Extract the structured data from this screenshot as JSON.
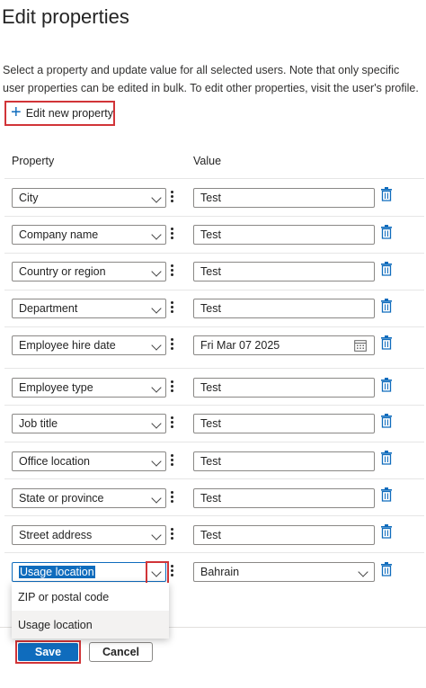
{
  "panel": {
    "title": "Edit properties",
    "description": "Select a property and update value for all selected users. Note that only specific user properties can be edited in bulk. To edit other properties, visit the user's profile.",
    "add_property_label": "Edit new property"
  },
  "table": {
    "property_header": "Property",
    "value_header": "Value",
    "rows": [
      {
        "property": "City",
        "value": "Test"
      },
      {
        "property": "Company name",
        "value": "Test"
      },
      {
        "property": "Country or region",
        "value": "Test"
      },
      {
        "property": "Department",
        "value": "Test"
      },
      {
        "property": "Employee hire date",
        "value": "Fri Mar 07 2025"
      },
      {
        "property": "Employee type",
        "value": "Test"
      },
      {
        "property": "Job title",
        "value": "Test"
      },
      {
        "property": "Office location",
        "value": "Test"
      },
      {
        "property": "State or province",
        "value": "Test"
      },
      {
        "property": "Street address",
        "value": "Test"
      },
      {
        "property": "Usage location",
        "value": "Bahrain"
      }
    ]
  },
  "dropdown": {
    "options": [
      "ZIP or postal code",
      "Usage location"
    ]
  },
  "footer": {
    "save_label": "Save",
    "cancel_label": "Cancel"
  },
  "colors": {
    "accent": "#0f6cbd",
    "highlight_border": "#d13438",
    "trash_icon": "#0f6cbd"
  }
}
